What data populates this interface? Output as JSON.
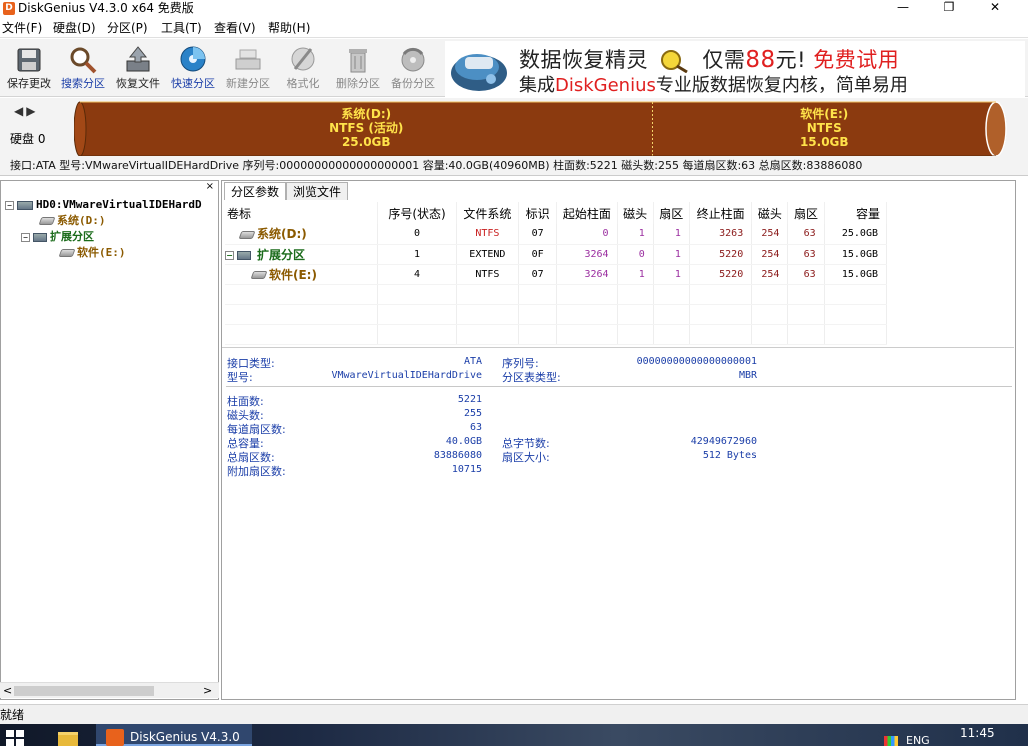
{
  "window": {
    "title": "DiskGenius V4.3.0 x64 免费版",
    "app_icon_letter": "D",
    "controls": {
      "minimize": "—",
      "maximize": "❐",
      "close": "✕"
    }
  },
  "menu": [
    "文件(F)",
    "硬盘(D)",
    "分区(P)",
    "工具(T)",
    "查看(V)",
    "帮助(H)"
  ],
  "toolbar": [
    {
      "label": "保存更改",
      "icon": "save-icon",
      "enabled": true
    },
    {
      "label": "搜索分区",
      "icon": "search-partition-icon",
      "enabled": true
    },
    {
      "label": "恢复文件",
      "icon": "recover-files-icon",
      "enabled": true
    },
    {
      "label": "快速分区",
      "icon": "quick-partition-icon",
      "enabled": true
    },
    {
      "label": "新建分区",
      "icon": "new-partition-icon",
      "enabled": false
    },
    {
      "label": "格式化",
      "icon": "format-icon",
      "enabled": false
    },
    {
      "label": "删除分区",
      "icon": "delete-partition-icon",
      "enabled": false
    },
    {
      "label": "备份分区",
      "icon": "backup-partition-icon",
      "enabled": false
    }
  ],
  "ad": {
    "line1_a": "数据恢复精灵",
    "line1_b": "仅需",
    "line1_price": "88",
    "line1_c": "元!",
    "line1_cta": "免费试用",
    "line2_a": "集成",
    "line2_brand": "DiskGenius",
    "line2_b": "专业版数据恢复内核，简单易用"
  },
  "disk_panel": {
    "nav_back": "◀",
    "nav_forward": "▶",
    "disk_label": "硬盘 0",
    "partitions": [
      {
        "name": "系统(D:)",
        "fs": "NTFS (活动)",
        "size": "25.0GB",
        "share": 0.625
      },
      {
        "name": "软件(E:)",
        "fs": "NTFS",
        "size": "15.0GB",
        "share": 0.375
      }
    ],
    "info": "接口:ATA  型号:VMwareVirtualIDEHardDrive  序列号:00000000000000000001  容量:40.0GB(40960MB)  柱面数:5221  磁头数:255  每道扇区数:63  总扇区数:83886080"
  },
  "tree": {
    "close": "×",
    "disk": "HD0:VMwareVirtualIDEHardD",
    "items": [
      {
        "label": "系统(D:)",
        "level": 1
      },
      {
        "label": "扩展分区",
        "level": 1
      },
      {
        "label": "软件(E:)",
        "level": 2
      }
    ],
    "scroll_left": "<",
    "scroll_right": ">"
  },
  "tabs": [
    "分区参数",
    "浏览文件"
  ],
  "table": {
    "headers": [
      "卷标",
      "序号(状态)",
      "文件系统",
      "标识",
      "起始柱面",
      "磁头",
      "扇区",
      "终止柱面",
      "磁头",
      "扇区",
      "容量"
    ],
    "rows": [
      {
        "name": "系统(D:)",
        "index": "0",
        "fs": "NTFS",
        "id": "07",
        "start_cyl": "0",
        "start_head": "1",
        "start_sec": "1",
        "end_cyl": "3263",
        "end_head": "254",
        "end_sec": "63",
        "capacity": "25.0GB"
      },
      {
        "name": "扩展分区",
        "index": "1",
        "fs": "EXTEND",
        "id": "0F",
        "start_cyl": "3264",
        "start_head": "0",
        "start_sec": "1",
        "end_cyl": "5220",
        "end_head": "254",
        "end_sec": "63",
        "capacity": "15.0GB"
      },
      {
        "name": "软件(E:)",
        "index": "4",
        "fs": "NTFS",
        "id": "07",
        "start_cyl": "3264",
        "start_head": "1",
        "start_sec": "1",
        "end_cyl": "5220",
        "end_head": "254",
        "end_sec": "63",
        "capacity": "15.0GB"
      }
    ]
  },
  "details": {
    "interface_type_label": "接口类型:",
    "interface_type": "ATA",
    "serial_label": "序列号:",
    "serial": "00000000000000000001",
    "model_label": "型号:",
    "model": "VMwareVirtualIDEHardDrive",
    "partition_table_label": "分区表类型:",
    "partition_table": "MBR",
    "cylinders_label": "柱面数:",
    "cylinders": "5221",
    "heads_label": "磁头数:",
    "heads": "255",
    "sectors_per_track_label": "每道扇区数:",
    "sectors_per_track": "63",
    "total_capacity_label": "总容量:",
    "total_capacity": "40.0GB",
    "total_bytes_label": "总字节数:",
    "total_bytes": "42949672960",
    "total_sectors_label": "总扇区数:",
    "total_sectors": "83886080",
    "sector_size_label": "扇区大小:",
    "sector_size": "512 Bytes",
    "extra_sectors_label": "附加扇区数:",
    "extra_sectors": "10715"
  },
  "status": "就绪",
  "taskbar": {
    "app_label": "DiskGenius V4.3.0",
    "lang": "ENG",
    "time": "11:45"
  },
  "colors": {
    "partition_fill": "#8b3a0f",
    "partition_text": "#ffe34a",
    "toolbar_bg": "#f3f3f3"
  }
}
